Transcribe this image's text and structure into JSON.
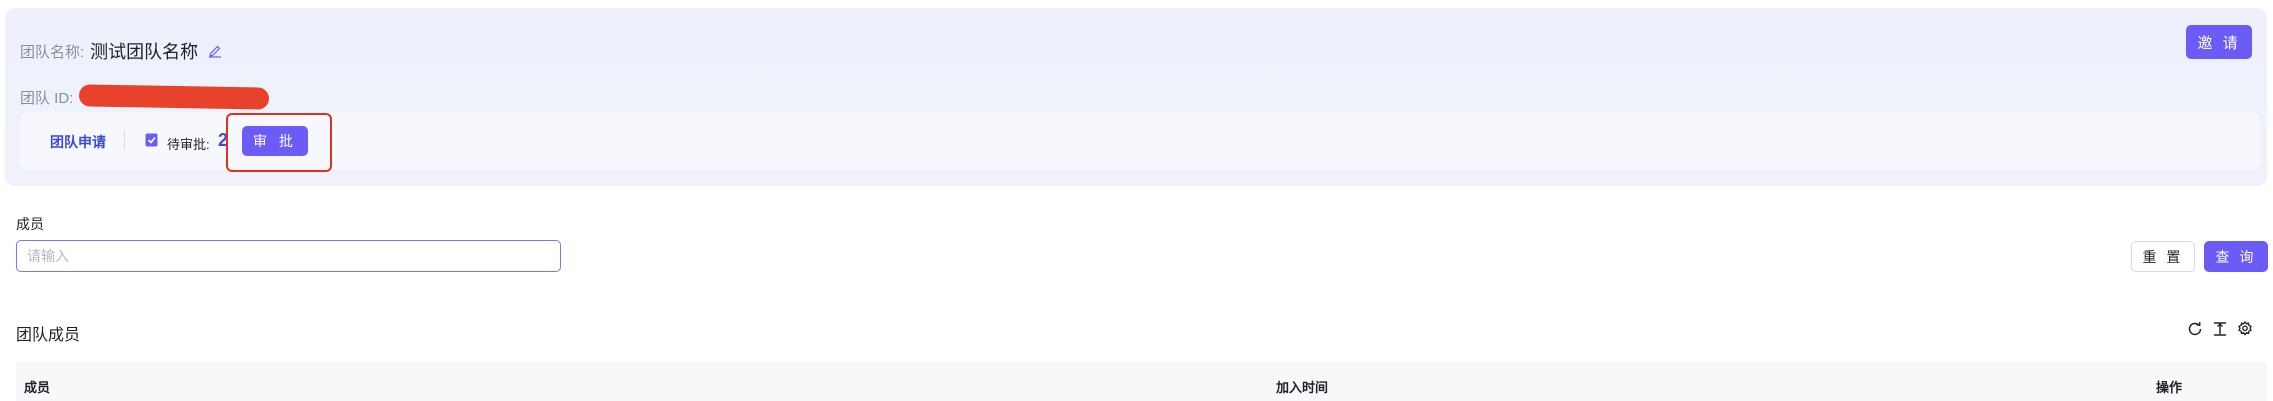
{
  "team": {
    "name_label": "团队名称:",
    "name_value": "测试团队名称",
    "id_label": "团队 ID:",
    "invite_label": "邀 请"
  },
  "apply": {
    "title": "团队申请",
    "pending_label": "待审批:",
    "pending_count": "2",
    "approve_label": "审 批"
  },
  "filter": {
    "member_label": "成员",
    "member_placeholder": "请输入",
    "reset_label": "重 置",
    "query_label": "查 询"
  },
  "section": {
    "title": "团队成员",
    "icons": [
      "refresh-icon",
      "column-height-icon",
      "settings-icon"
    ]
  },
  "table": {
    "columns": [
      "成员",
      "加入时间",
      "操作"
    ]
  },
  "colors": {
    "primary": "#6b5cf5",
    "link": "#3b4bd8",
    "highlight": "#e0311f",
    "redaction": "#e8412c"
  }
}
